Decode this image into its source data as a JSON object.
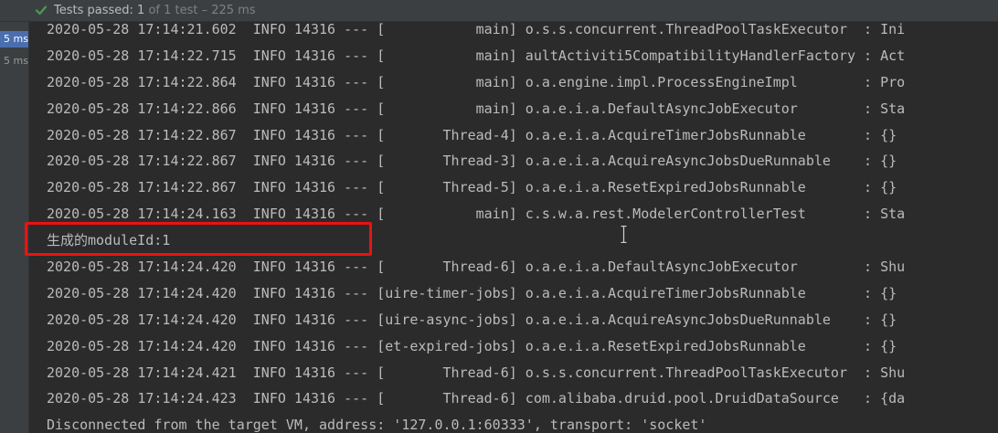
{
  "header": {
    "passed_label": "Tests passed: 1",
    "detail_label": " of 1 test – 225 ms",
    "icon": "check-icon",
    "accent_color": "#499c54"
  },
  "test_tree": {
    "durations": [
      "5 ms",
      "5 ms"
    ]
  },
  "console": {
    "lines": [
      "2020-05-28 17:14:21.602  INFO 14316 --- [           main] o.s.s.concurrent.ThreadPoolTaskExecutor  : Ini",
      "2020-05-28 17:14:22.715  INFO 14316 --- [           main] aultActiviti5CompatibilityHandlerFactory : Act",
      "2020-05-28 17:14:22.864  INFO 14316 --- [           main] o.a.engine.impl.ProcessEngineImpl        : Pro",
      "2020-05-28 17:14:22.866  INFO 14316 --- [           main] o.a.e.i.a.DefaultAsyncJobExecutor        : Sta",
      "2020-05-28 17:14:22.867  INFO 14316 --- [       Thread-4] o.a.e.i.a.AcquireTimerJobsRunnable       : {}",
      "2020-05-28 17:14:22.867  INFO 14316 --- [       Thread-3] o.a.e.i.a.AcquireAsyncJobsDueRunnable    : {}",
      "2020-05-28 17:14:22.867  INFO 14316 --- [       Thread-5] o.a.e.i.a.ResetExpiredJobsRunnable       : {}",
      "2020-05-28 17:14:24.163  INFO 14316 --- [           main] c.s.w.a.rest.ModelerControllerTest       : Sta",
      "生成的moduleId:1",
      "2020-05-28 17:14:24.420  INFO 14316 --- [       Thread-6] o.a.e.i.a.DefaultAsyncJobExecutor        : Shu",
      "2020-05-28 17:14:24.420  INFO 14316 --- [uire-timer-jobs] o.a.e.i.a.AcquireTimerJobsRunnable       : {}",
      "2020-05-28 17:14:24.420  INFO 14316 --- [uire-async-jobs] o.a.e.i.a.AcquireAsyncJobsDueRunnable    : {}",
      "2020-05-28 17:14:24.420  INFO 14316 --- [et-expired-jobs] o.a.e.i.a.ResetExpiredJobsRunnable       : {}",
      "2020-05-28 17:14:24.421  INFO 14316 --- [       Thread-6] o.s.s.concurrent.ThreadPoolTaskExecutor  : Shu",
      "2020-05-28 17:14:24.423  INFO 14316 --- [       Thread-6] com.alibaba.druid.pool.DruidDataSource   : {da",
      "Disconnected from the target VM, address: '127.0.0.1:60333', transport: 'socket'"
    ],
    "highlight_color": "#ee1111",
    "cursor_icon": "text-cursor-icon"
  }
}
